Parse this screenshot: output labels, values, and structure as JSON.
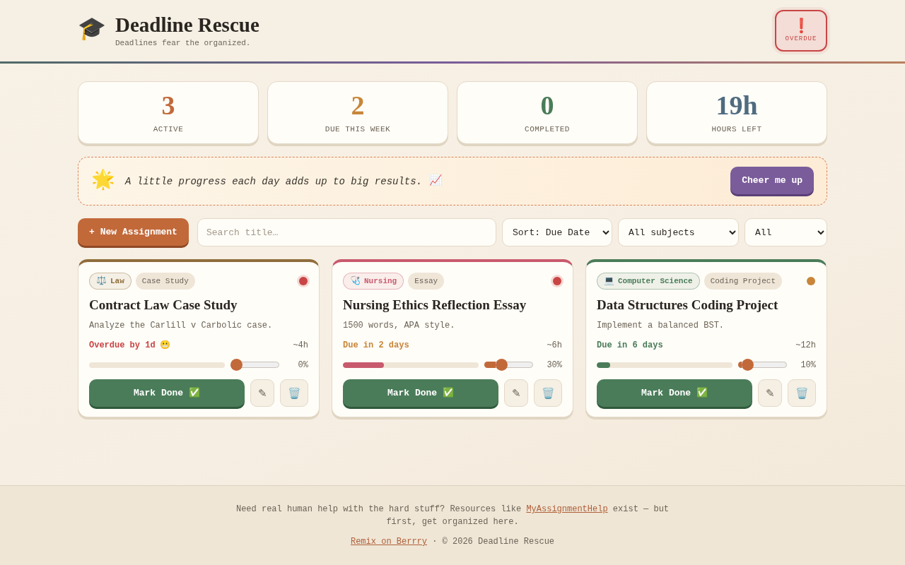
{
  "header": {
    "logo": "🎓",
    "title": "Deadline Rescue",
    "tagline": "Deadlines fear the organized.",
    "alert": {
      "symbol": "❗",
      "label": "OVERDUE"
    }
  },
  "stats": [
    {
      "value": "3",
      "label": "ACTIVE",
      "color": "#c2693a"
    },
    {
      "value": "2",
      "label": "DUE THIS WEEK",
      "color": "#c8863a"
    },
    {
      "value": "0",
      "label": "COMPLETED",
      "color": "#4a7c59"
    },
    {
      "value": "19h",
      "label": "HOURS LEFT",
      "color": "#4f6b80"
    }
  ],
  "motivation": {
    "icon": "🌟",
    "quote": "A little progress each day adds up to big results.",
    "quote_icon": "📈",
    "button": "Cheer me up"
  },
  "toolbar": {
    "new_button": "+ New Assignment",
    "search": {
      "placeholder": "Search title…"
    },
    "filters": [
      {
        "value": "Sort: Due Date"
      },
      {
        "value": "All subjects"
      },
      {
        "value": "All"
      }
    ]
  },
  "assignments": [
    {
      "subject": {
        "icon": "⚖️",
        "label": "Law",
        "color": "#8f6d3b"
      },
      "type": "Case Study",
      "status_dot": {
        "color": "#c94545",
        "glow": true
      },
      "title": "Contract Law Case Study",
      "description": "Analyze the Carlill v Carbolic case.",
      "due": {
        "text": "Overdue by 1d",
        "icon": "😬",
        "color": "#c94545"
      },
      "estimate": "~4h",
      "level": 0,
      "percent": "0%",
      "actions": {
        "done": "Mark Done",
        "done_icon": "✅",
        "edit": "✎",
        "delete": "🗑️"
      }
    },
    {
      "subject": {
        "icon": "🩺",
        "label": "Nursing",
        "color": "#c85a6e"
      },
      "type": "Essay",
      "status_dot": {
        "color": "#c94545",
        "glow": true
      },
      "title": "Nursing Ethics Reflection Essay",
      "description": "1500 words, APA style.",
      "due": {
        "text": "Due in 2 days",
        "color": "#c8863a"
      },
      "estimate": "~6h",
      "level": 0.3,
      "percent": "30%",
      "actions": {
        "done": "Mark Done",
        "done_icon": "✅",
        "edit": "✎",
        "delete": "🗑️"
      }
    },
    {
      "subject": {
        "icon": "💻",
        "label": "Computer Science",
        "color": "#4a7c59"
      },
      "type": "Coding Project",
      "status_dot": {
        "color": "#c8863a",
        "glow": false
      },
      "title": "Data Structures Coding Project",
      "description": "Implement a balanced BST.",
      "due": {
        "text": "Due in 6 days",
        "color": "#4a7c59"
      },
      "estimate": "~12h",
      "level": 0.1,
      "percent": "10%",
      "actions": {
        "done": "Mark Done",
        "done_icon": "✅",
        "edit": "✎",
        "delete": "🗑️"
      }
    }
  ],
  "footer": {
    "note": {
      "before": "Need real human help with the hard stuff? Resources like",
      "link": "MyAssignmentHelp",
      "after": "exist — but first, get organized here."
    },
    "credit": {
      "link": "Remix on Berrry",
      "text": "· © 2026 Deadline Rescue"
    }
  }
}
